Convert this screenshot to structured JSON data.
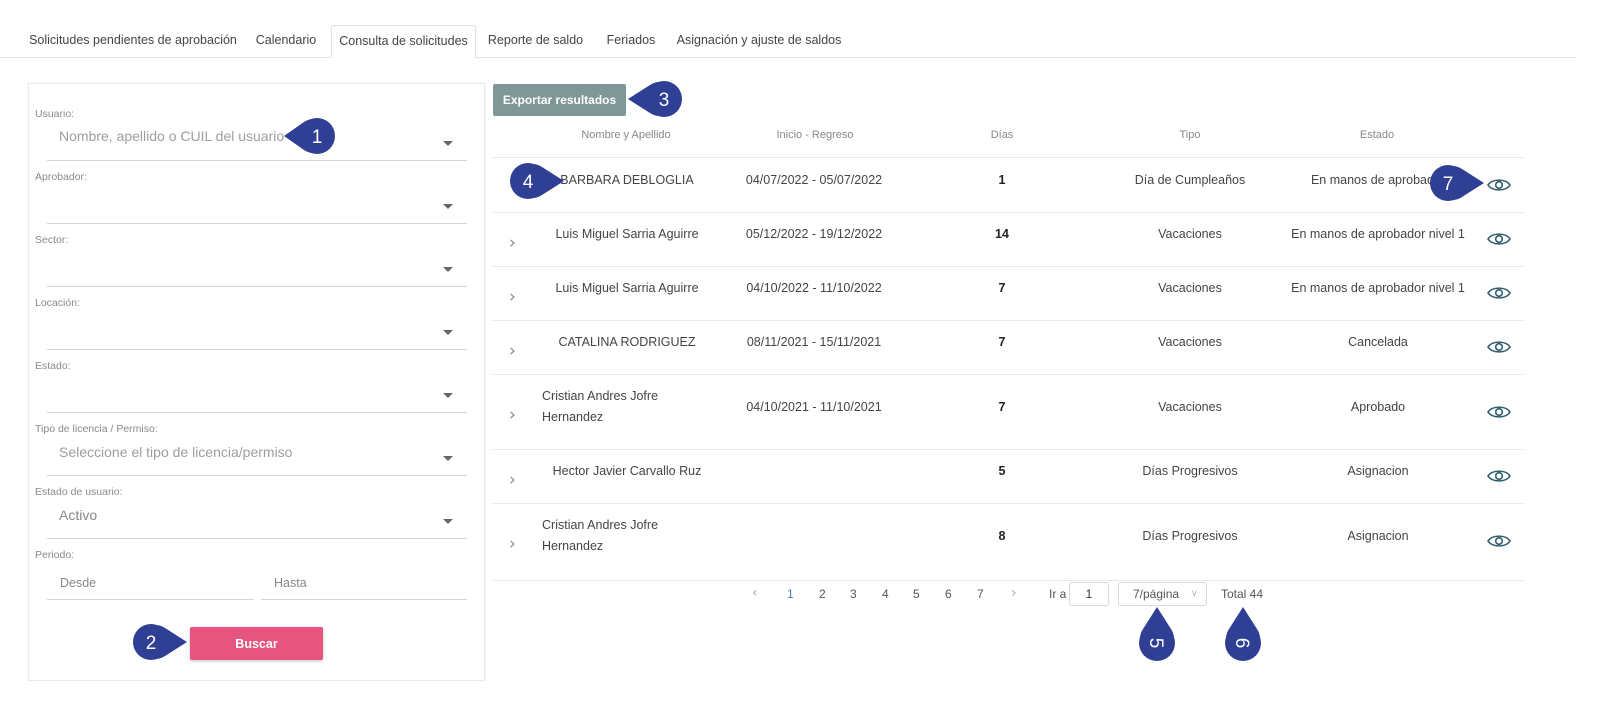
{
  "tabs": [
    {
      "label": "Solicitudes pendientes de aprobación"
    },
    {
      "label": "Calendario"
    },
    {
      "label": "Consulta de solicitudes"
    },
    {
      "label": "Reporte de saldo"
    },
    {
      "label": "Feriados"
    },
    {
      "label": "Asignación y ajuste de saldos"
    }
  ],
  "active_tab": "Consulta de solicitudes",
  "filters": {
    "usuario": {
      "label": "Usuario:",
      "placeholder": "Nombre, apellido o CUIL del usuario"
    },
    "aprobador": {
      "label": "Aprobador:"
    },
    "sector": {
      "label": "Sector:"
    },
    "locacion": {
      "label": "Locación:"
    },
    "estado": {
      "label": "Estado:"
    },
    "tipo": {
      "label": "Tipo de licencia / Permiso:",
      "placeholder": "Seleccione el tipo de licencia/permiso"
    },
    "estado_usuario": {
      "label": "Estado de usuario:",
      "value": "Activo"
    },
    "periodo": {
      "label": "Periodo:",
      "desde": "Desde",
      "hasta": "Hasta"
    },
    "search_label": "Buscar"
  },
  "export_label": "Exportar resultados",
  "table": {
    "headers": [
      "Nombre y Apellido",
      "Inicio - Regreso",
      "Días",
      "Tipo",
      "Estado"
    ],
    "rows": [
      {
        "name": "BARBARA DEBLOGLIA",
        "dates": "04/07/2022 - 05/07/2022",
        "days": "1",
        "type": "Día de Cumpleaños",
        "status": "En manos de aprobador"
      },
      {
        "name": "Luis Miguel Sarria Aguirre",
        "dates": "05/12/2022 - 19/12/2022",
        "days": "14",
        "type": "Vacaciones",
        "status": "En manos de aprobador nivel 1"
      },
      {
        "name": "Luis Miguel Sarria Aguirre",
        "dates": "04/10/2022 - 11/10/2022",
        "days": "7",
        "type": "Vacaciones",
        "status": "En manos de aprobador nivel 1"
      },
      {
        "name": "CATALINA RODRIGUEZ",
        "dates": "08/11/2021 - 15/11/2021",
        "days": "7",
        "type": "Vacaciones",
        "status": "Cancelada"
      },
      {
        "name_line1": "Cristian Andres Jofre",
        "name_line2": "Hernandez",
        "dates": "04/10/2021 - 11/10/2021",
        "days": "7",
        "type": "Vacaciones",
        "status": "Aprobado"
      },
      {
        "name": "Hector Javier Carvallo Ruz",
        "dates": "",
        "days": "5",
        "type": "Días Progresivos",
        "status": "Asignacion"
      },
      {
        "name_line1": "Cristian Andres Jofre",
        "name_line2": "Hernandez",
        "dates": "",
        "days": "8",
        "type": "Días Progresivos",
        "status": "Asignacion"
      }
    ]
  },
  "pagination": {
    "prev_icon": "‹",
    "pages": [
      "1",
      "2",
      "3",
      "4",
      "5",
      "6",
      "7"
    ],
    "current_page": "1",
    "next_icon": "›",
    "goto_label": "Ir a",
    "goto_value": "1",
    "page_size": "7/página",
    "total": "Total 44"
  },
  "callouts": [
    "1",
    "2",
    "3",
    "4",
    "5",
    "6",
    "7"
  ],
  "colors": {
    "callout": "#2e3f94",
    "search_button": "#e5557f",
    "export_button": "#7f9797",
    "active_page": "#3b7dd8",
    "eye_icon": "#2f5d6b"
  },
  "icons": [
    "chevron-right-icon",
    "eye-icon",
    "dropdown-caret-icon",
    "chevron-left-icon"
  ]
}
